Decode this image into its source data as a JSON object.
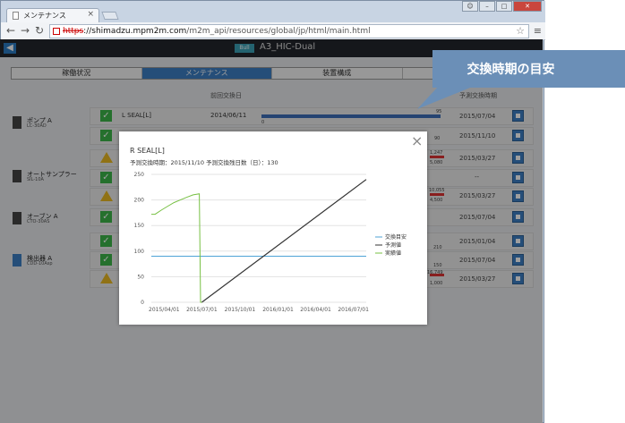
{
  "browser": {
    "tab_title": "メンテナンス",
    "tab_close": "×",
    "url_scheme": "https",
    "url_host": "://shimadzu.mpm2m.com",
    "url_path": "/m2m_api/resources/global/jp/html/main.html"
  },
  "app": {
    "back_icon": "arrow-left-icon",
    "model_tag": "Bull",
    "title": "A3_HIC-Dual"
  },
  "tabs": [
    "稼働状況",
    "メンテナンス",
    "装置構成",
    ""
  ],
  "columns": {
    "last_replace": "前回交換日",
    "next_replace": "予測交換時期"
  },
  "devices": [
    {
      "name": "ポンプ A",
      "model": "LC-30AD"
    },
    {
      "name": "オートサンプラー",
      "model": "SIL-10A"
    },
    {
      "name": "オーブン A",
      "model": "CTO-30AS"
    },
    {
      "name": "検出器 A",
      "model": "CDD-10Asp"
    }
  ],
  "first_row": {
    "part": "L SEAL[L]",
    "date": "2014/06/11",
    "bar_max": "95",
    "bar_min": "0"
  },
  "right_dates": [
    "2015/07/04",
    "2015/11/10",
    "2015/03/27",
    "--",
    "2015/03/27",
    "2015/07/04",
    "2015/01/04",
    "2015/07/04",
    "2015/03/27"
  ],
  "side_numbers": [
    "90",
    "1,247",
    "5,080",
    "10,055",
    "4,500",
    "210",
    "150",
    "16,749",
    "1,000"
  ],
  "modal": {
    "title": "R SEAL[L]",
    "subtitle": "予測交換時期：2015/11/10  予測交換残日数（日）：130",
    "close": "×"
  },
  "chart_data": {
    "type": "line",
    "x_ticks": [
      "2015/04/01",
      "2015/07/01",
      "2015/10/01",
      "2016/01/01",
      "2016/04/01",
      "2016/07/01"
    ],
    "y_ticks": [
      "0",
      "50",
      "100",
      "150",
      "200",
      "250"
    ],
    "ylim": [
      0,
      250
    ],
    "xlim": [
      "2015/03/01",
      "2016/08/01"
    ],
    "grid": true,
    "legend_position": "right",
    "series": [
      {
        "name": "交換目安",
        "color": "#4fa3d6",
        "points": [
          [
            "2015/03/01",
            90
          ],
          [
            "2016/08/01",
            90
          ]
        ]
      },
      {
        "name": "予測値",
        "color": "#333333",
        "points": [
          [
            "2015/07/01",
            0
          ],
          [
            "2016/08/01",
            240
          ]
        ]
      },
      {
        "name": "実績値",
        "color": "#77c043",
        "points": [
          [
            "2015/03/01",
            172
          ],
          [
            "2015/03/10",
            172
          ],
          [
            "2015/03/25",
            180
          ],
          [
            "2015/04/10",
            188
          ],
          [
            "2015/04/25",
            195
          ],
          [
            "2015/05/10",
            200
          ],
          [
            "2015/05/25",
            205
          ],
          [
            "2015/06/10",
            210
          ],
          [
            "2015/06/25",
            212
          ],
          [
            "2015/06/28",
            0
          ],
          [
            "2015/07/01",
            0
          ]
        ]
      }
    ]
  },
  "callout": {
    "text": "交換時期の目安"
  }
}
